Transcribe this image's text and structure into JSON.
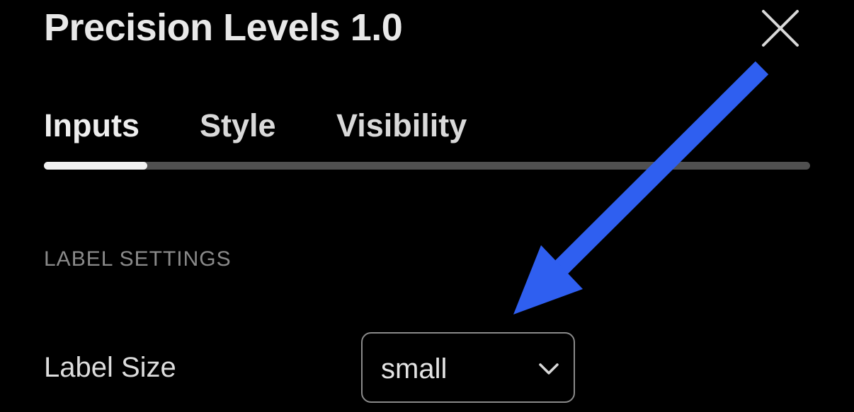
{
  "dialog": {
    "title": "Precision Levels 1.0",
    "close_icon": "close-icon"
  },
  "tabs": [
    {
      "label": "Inputs",
      "active": true
    },
    {
      "label": "Style",
      "active": false
    },
    {
      "label": "Visibility",
      "active": false
    }
  ],
  "section": {
    "header": "LABEL SETTINGS"
  },
  "fields": {
    "label_size": {
      "label": "Label Size",
      "value": "small",
      "icon": "chevron-down-icon"
    }
  },
  "annotation": {
    "icon": "arrow-annotation-icon",
    "color": "#2f5ff0"
  },
  "colors": {
    "background": "#000000",
    "text": "#e8e8e8",
    "muted": "#8a8a8a",
    "track": "#505050",
    "indicator": "#f0f0f0"
  }
}
